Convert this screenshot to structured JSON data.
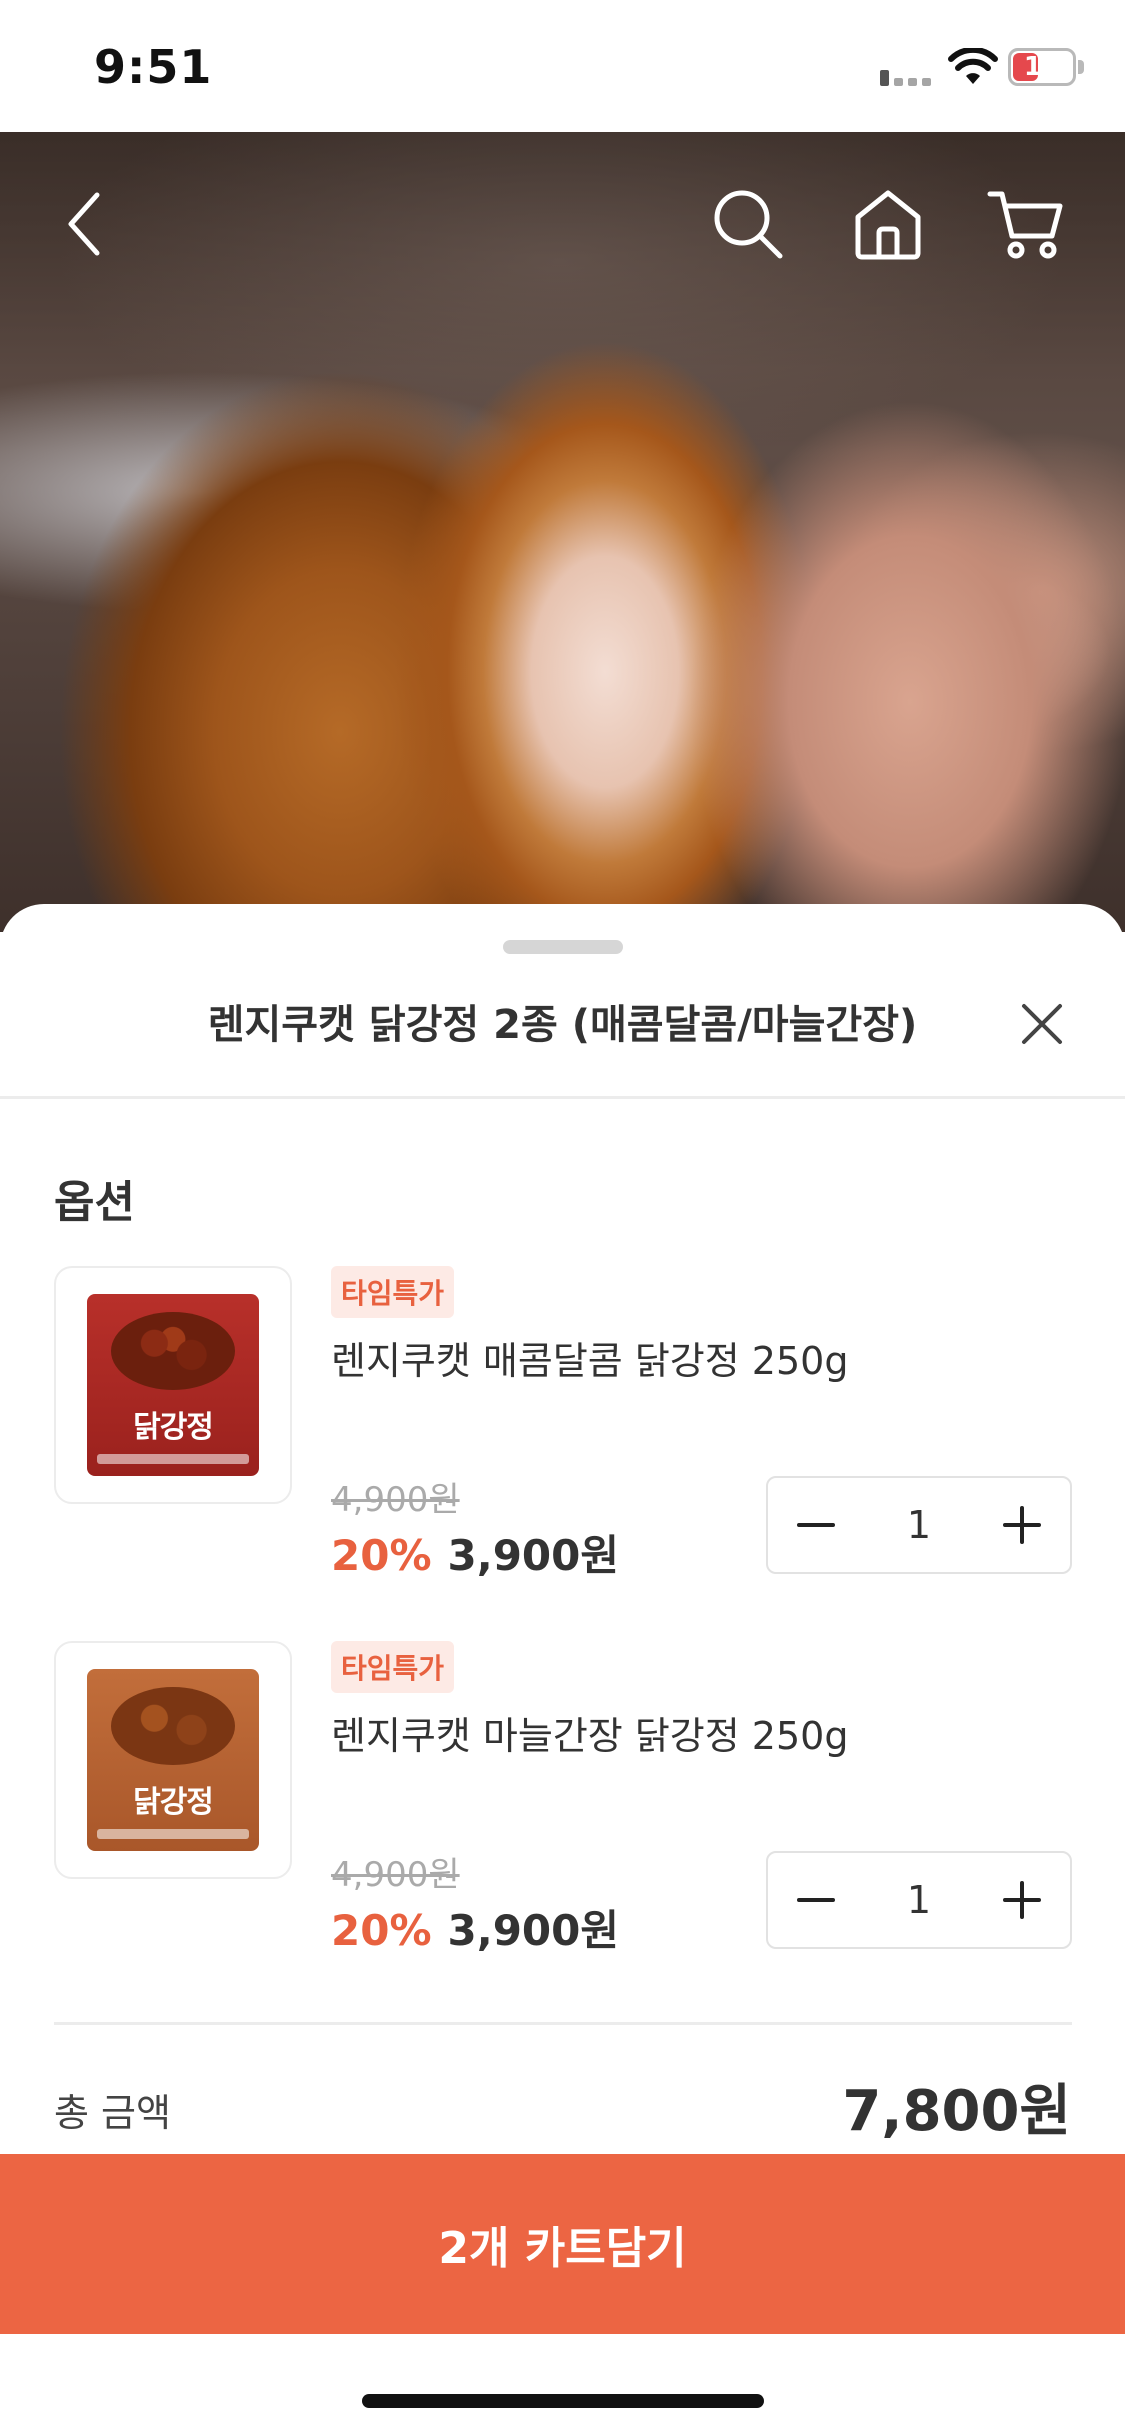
{
  "status_bar": {
    "time": "9:51",
    "battery": "11"
  },
  "nav": {
    "back_icon": "chevron-left-icon",
    "search_icon": "search-icon",
    "home_icon": "home-icon",
    "cart_icon": "cart-icon"
  },
  "sheet": {
    "title": "렌지쿠캣 닭강정 2종 (매콤달콤/마늘간장)",
    "close_icon": "close-icon",
    "section_title": "옵션",
    "options": [
      {
        "badge": "타임특가",
        "name": "렌지쿠캣 매콤달콤 닭강정 250g",
        "original_price": "4,900원",
        "discount": "20%",
        "price": "3,900원",
        "quantity": "1",
        "pack_label": "닭강정"
      },
      {
        "badge": "타임특가",
        "name": "렌지쿠캣 마늘간장 닭강정 250g",
        "original_price": "4,900원",
        "discount": "20%",
        "price": "3,900원",
        "quantity": "1",
        "pack_label": "닭강정"
      }
    ],
    "total_label": "총 금액",
    "total_value": "7,800원",
    "cta_label": "2개 카트담기"
  },
  "colors": {
    "accent": "#ec6543",
    "badge_bg": "#fdeae5",
    "badge_text": "#e8613f"
  }
}
